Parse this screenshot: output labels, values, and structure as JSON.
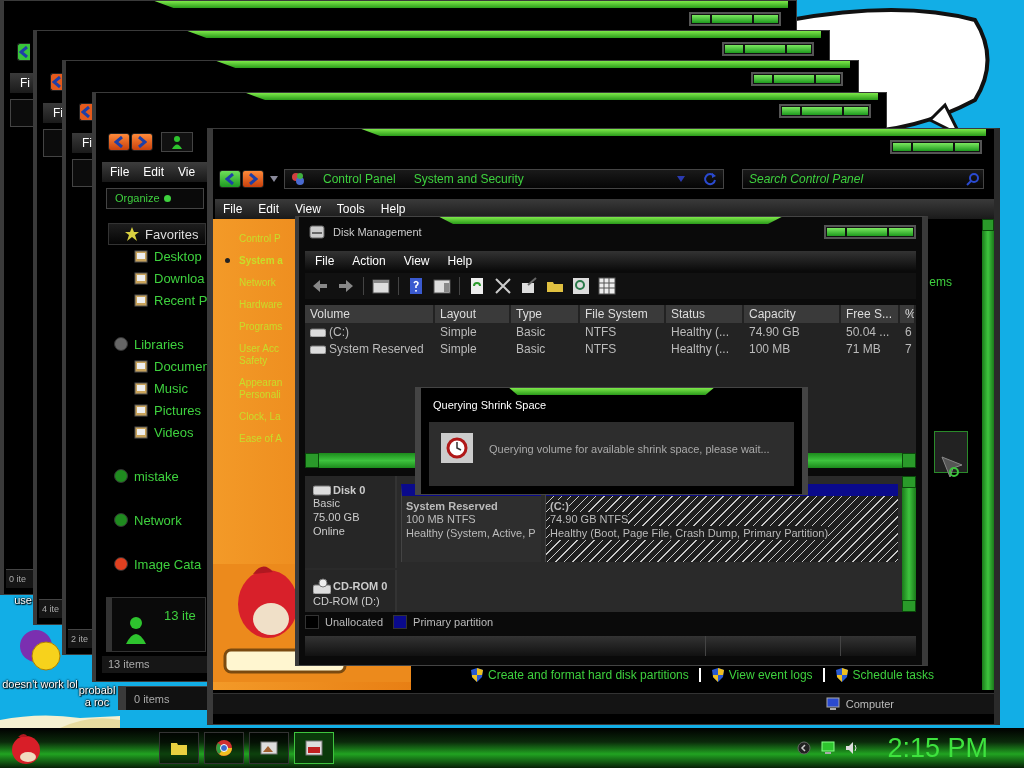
{
  "desktop_icons": [
    {
      "label": "use",
      "kind": "label"
    },
    {
      "label": "doesn't work lol",
      "kind": "icon"
    },
    {
      "label": "probabl a roc",
      "kind": "label"
    }
  ],
  "back_windows": [
    {
      "color": "#39c43b",
      "menu": "Fi",
      "status": "0 ite"
    },
    {
      "color": "#e45a1c",
      "menu": "Fi",
      "status": "4 ite"
    },
    {
      "color": "#e45a1c",
      "menu": "Fi",
      "status": "2 ite"
    }
  ],
  "lower_window": {
    "status": "0 items"
  },
  "explorer": {
    "menu": [
      "File",
      "Edit",
      "Vie"
    ],
    "organize": "Organize",
    "nav": [
      {
        "label": "Favorites",
        "kind": "boxed",
        "children": [
          {
            "label": "Desktop"
          },
          {
            "label": "Downloa"
          },
          {
            "label": "Recent P"
          }
        ]
      },
      {
        "label": "Libraries",
        "kind": "plain",
        "children": [
          {
            "label": "Documen"
          },
          {
            "label": "Music"
          },
          {
            "label": "Pictures"
          },
          {
            "label": "Videos"
          }
        ]
      },
      {
        "label": "mistake",
        "kind": "plain"
      },
      {
        "label": "Network",
        "kind": "plain"
      },
      {
        "label": "Image Cata",
        "kind": "plain"
      }
    ],
    "details": "13 ite",
    "status": "13 items"
  },
  "control_panel": {
    "address": [
      "Control Panel",
      "System and Security"
    ],
    "search": {
      "placeholder": "Search Control Panel"
    },
    "menu": [
      "File",
      "Edit",
      "View",
      "Tools",
      "Help"
    ],
    "side_links": [
      {
        "label": "Control P",
        "selected": false
      },
      {
        "label": "System a",
        "selected": true
      },
      {
        "label": "Network",
        "selected": false
      },
      {
        "label": "Hardware",
        "selected": false
      },
      {
        "label": "Programs",
        "selected": false
      },
      {
        "label": "User Acc Safety",
        "selected": false
      },
      {
        "label": "Appearan Personali",
        "selected": false
      },
      {
        "label": "Clock, La",
        "selected": false
      },
      {
        "label": "Ease of A",
        "selected": false
      }
    ],
    "content_text": "ems",
    "tasks": [
      "Create and format hard disk partitions",
      "View event logs",
      "Schedule tasks"
    ],
    "status": "Computer"
  },
  "disk_management": {
    "title": "Disk Management",
    "menu": [
      "File",
      "Action",
      "View",
      "Help"
    ],
    "columns": [
      "Volume",
      "Layout",
      "Type",
      "File System",
      "Status",
      "Capacity",
      "Free S...",
      "%"
    ],
    "rows": [
      [
        "(C:)",
        "Simple",
        "Basic",
        "NTFS",
        "Healthy (...",
        "74.90 GB",
        "50.04 ...",
        "6"
      ],
      [
        "System Reserved",
        "Simple",
        "Basic",
        "NTFS",
        "Healthy (...",
        "100 MB",
        "71 MB",
        "7"
      ]
    ],
    "disks": [
      {
        "name": "Disk 0",
        "kind": "disk",
        "lines": [
          "Basic",
          "75.00 GB",
          "Online"
        ],
        "partitions": [
          {
            "name": "System Reserved",
            "size": "100 MB NTFS",
            "status": "Healthy (System, Active, P",
            "selected": false
          },
          {
            "name": "(C:)",
            "size": "74.90 GB NTFS",
            "status": "Healthy (Boot, Page File, Crash Dump, Primary Partition)",
            "selected": true
          }
        ]
      },
      {
        "name": "CD-ROM 0",
        "kind": "cdrom",
        "lines": [
          "CD-ROM (D:)"
        ]
      }
    ],
    "legend": [
      {
        "label": "Unallocated",
        "color": "#000000"
      },
      {
        "label": "Primary partition",
        "color": "#0a0a8c"
      }
    ]
  },
  "dialog": {
    "title": "Querying Shrink Space",
    "message": "Querying volume for available shrink space, please wait..."
  },
  "taskbar": {
    "buttons": [
      {
        "selected": false
      },
      {
        "selected": false
      },
      {
        "selected": false
      },
      {
        "selected": true
      }
    ],
    "clock": "2:15 PM"
  }
}
